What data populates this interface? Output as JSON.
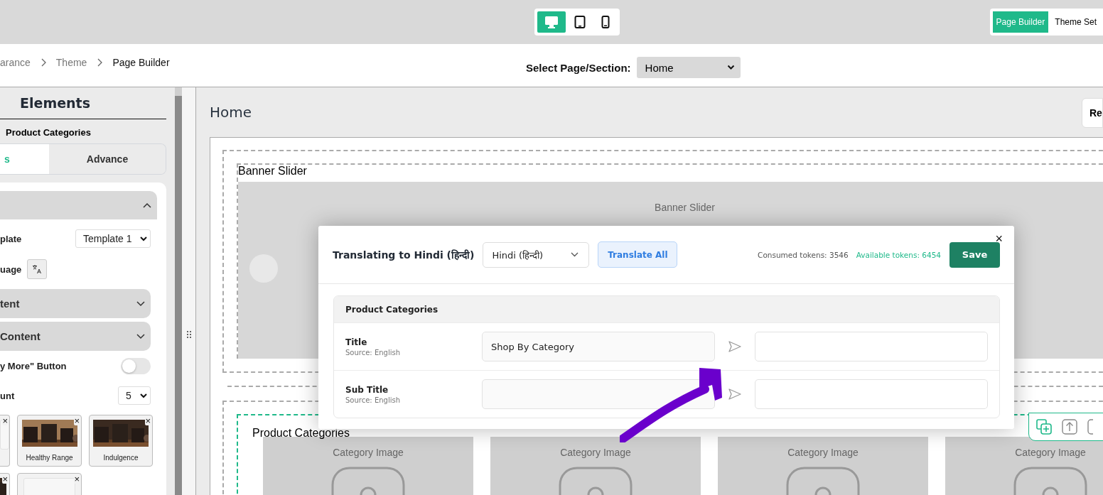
{
  "device_switcher": [
    {
      "kind": "desktop",
      "selected": true
    },
    {
      "kind": "tablet",
      "selected": false
    },
    {
      "kind": "mobile",
      "selected": false
    }
  ],
  "top_tabs": [
    {
      "label": "Page Builder",
      "selected": true
    },
    {
      "label": "Theme Set",
      "selected": false
    }
  ],
  "breadcrumb": [
    "arance",
    "Theme",
    "Page Builder"
  ],
  "page_select": {
    "label": "Select Page/Section:",
    "value": "Home"
  },
  "sidebar": {
    "title": "Elements",
    "subtitle": "Product Categories",
    "tabs": [
      {
        "label": "s",
        "selected": true
      },
      {
        "label": "Advance",
        "selected": false
      }
    ],
    "section_expanded": true,
    "template": {
      "label": "plate",
      "value": "Template 1"
    },
    "language": {
      "label": "uage"
    },
    "accordions": [
      {
        "label": "tent",
        "expanded": false
      },
      {
        "label": "Content",
        "expanded": false
      }
    ],
    "toggle": {
      "label": "y More\" Button",
      "on": false
    },
    "count": {
      "label": "unt",
      "value": "5"
    },
    "thumbnails": [
      {
        "kind": "blank",
        "remove": "×"
      },
      {
        "kind": "picture",
        "caption": "Healthy Range",
        "remove": "×"
      },
      {
        "kind": "picture",
        "caption": "Indulgence",
        "remove": "×"
      },
      {
        "kind": "picture",
        "remove": "×"
      },
      {
        "kind": "blank",
        "remove": "×"
      }
    ]
  },
  "canvas": {
    "title": "Home",
    "reset_button": "Re",
    "banner": {
      "label": "Banner Slider",
      "placeholder": "Banner Slider"
    },
    "categories": {
      "label": "Product Categories",
      "cards": [
        "Category Image",
        "Category Image",
        "Category Image",
        "Category Image"
      ]
    }
  },
  "modal": {
    "title": "Translating to Hindi (हिन्दी)",
    "language": "Hindi (हिन्दी)",
    "translate_all": "Translate All",
    "consumed": "Consumed tokens: 3546",
    "available": "Available tokens: 6454",
    "save": "Save",
    "close": "×",
    "group": "Product Categories",
    "rows": [
      {
        "label": "Title",
        "source_note": "Source: English",
        "source_value": "Shop By Category"
      },
      {
        "label": "Sub Title",
        "source_note": "Source: English"
      }
    ]
  }
}
